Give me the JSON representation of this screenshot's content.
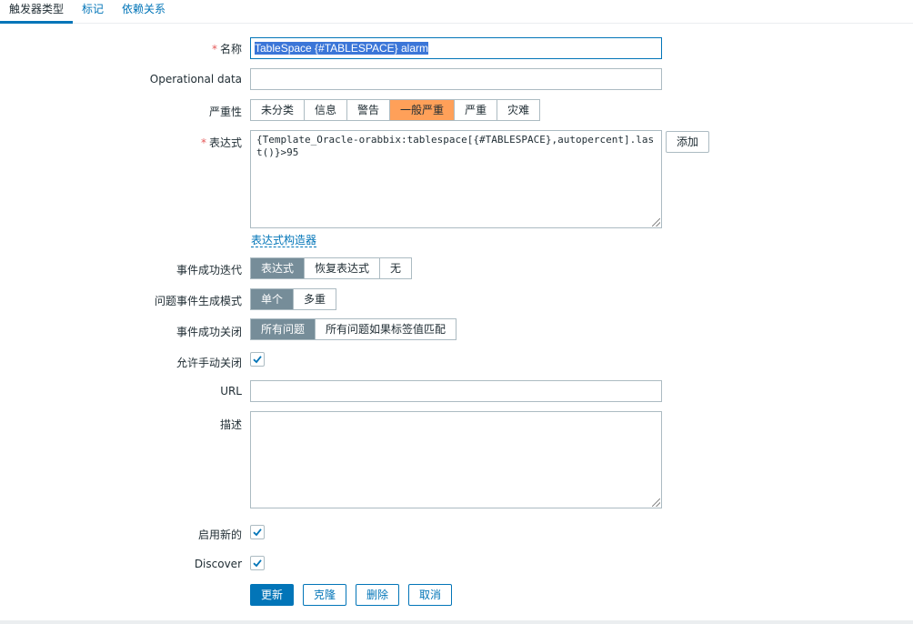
{
  "tabs": [
    {
      "label": "触发器类型",
      "active": true
    },
    {
      "label": "标记",
      "active": false
    },
    {
      "label": "依赖关系",
      "active": false
    }
  ],
  "form": {
    "name": {
      "label": "名称",
      "value": "TableSpace {#TABLESPACE} alarm"
    },
    "opdata": {
      "label": "Operational data",
      "value": ""
    },
    "severity": {
      "label": "严重性",
      "options": [
        "未分类",
        "信息",
        "警告",
        "一般严重",
        "严重",
        "灾难"
      ],
      "selected": "一般严重"
    },
    "expression": {
      "label": "表达式",
      "value": "{Template_Oracle-orabbix:tablespace[{#TABLESPACE},autopercent].last()}>95",
      "add_label": "添加",
      "builder_link": "表达式构造器"
    },
    "ok_event": {
      "label": "事件成功迭代",
      "options": [
        "表达式",
        "恢复表达式",
        "无"
      ],
      "selected": "表达式"
    },
    "problem_mode": {
      "label": "问题事件生成模式",
      "options": [
        "单个",
        "多重"
      ],
      "selected": "单个"
    },
    "ok_close": {
      "label": "事件成功关闭",
      "options": [
        "所有问题",
        "所有问题如果标签值匹配"
      ],
      "selected": "所有问题"
    },
    "manual_close": {
      "label": "允许手动关闭",
      "checked": true
    },
    "url": {
      "label": "URL",
      "value": ""
    },
    "description": {
      "label": "描述",
      "value": ""
    },
    "enabled": {
      "label": "启用新的",
      "checked": true
    },
    "discover": {
      "label": "Discover",
      "checked": true
    }
  },
  "buttons": {
    "update": "更新",
    "clone": "克隆",
    "delete": "删除",
    "cancel": "取消"
  },
  "colors": {
    "accent": "#0275b8",
    "severity_average": "#ffa059",
    "segment_selected": "#768d99",
    "required": "#e45959"
  }
}
